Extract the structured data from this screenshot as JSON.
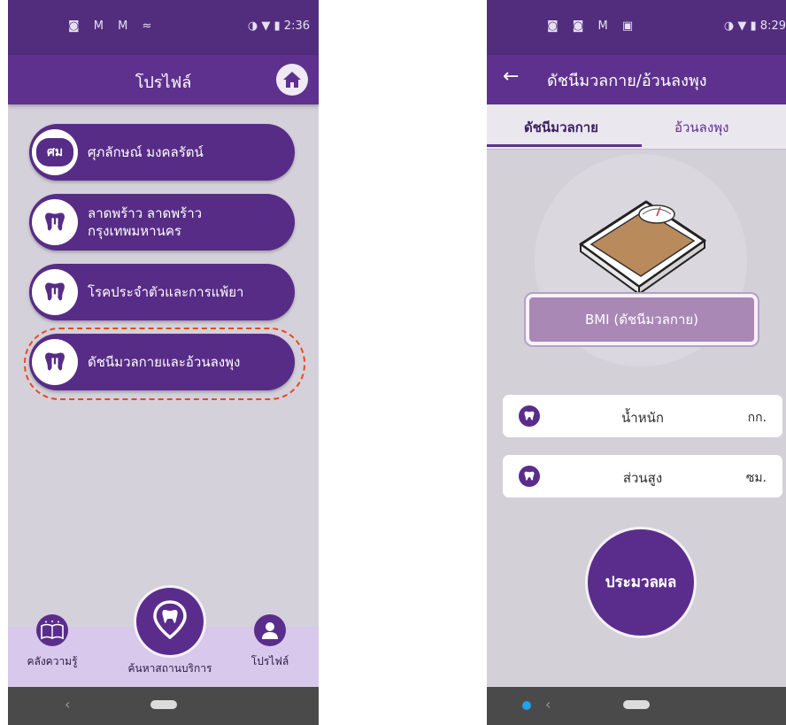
{
  "screen1": {
    "status": {
      "left_icons": "◙ Ⅿ Ⅿ ≈",
      "time": "2:36",
      "right_icons": "◑ ▼ ▮"
    },
    "title": "โปรไฟล์",
    "profile": {
      "initials": "ศม",
      "name": "ศุภลักษณ์ มงคลรัตน์"
    },
    "menu": [
      {
        "label": "ลาดพร้าว ลาดพร้าว",
        "label2": "กรุงเทพมหานคร"
      },
      {
        "label": "โรคประจำตัวและการแพ้ยา"
      },
      {
        "label": "ดัชนีมวลกายและอ้วนลงพุง"
      }
    ],
    "nav": {
      "knowledge": "คลังความรู้",
      "find_service": "ค้นหาสถานบริการ",
      "profile": "โปรไฟล์"
    }
  },
  "screen2": {
    "status": {
      "left_icons": "◙ ◙ Ⅿ ▣",
      "time": "8:29",
      "right_icons": "◑ ▼ ▮"
    },
    "title": "ดัชนีมวลกาย/อ้วนลงพุง",
    "tabs": [
      "ดัชนีมวลกาย",
      "อ้วนลงพุง"
    ],
    "bmi_button": "BMI (ดัชนีมวลกาย)",
    "weight": {
      "label": "น้ำหนัก",
      "unit": "กก."
    },
    "height": {
      "label": "ส่วนสูง",
      "unit": "ซม."
    },
    "process": "ประมวลผล"
  },
  "colors": {
    "primary": "#5e318e",
    "highlight": "#e8491e",
    "nav_bg": "#d8c8ec"
  },
  "icons": [
    "home-icon",
    "tooth-icon",
    "book-icon",
    "location-tooth-icon",
    "person-icon",
    "scale-icon",
    "back-arrow-icon"
  ]
}
